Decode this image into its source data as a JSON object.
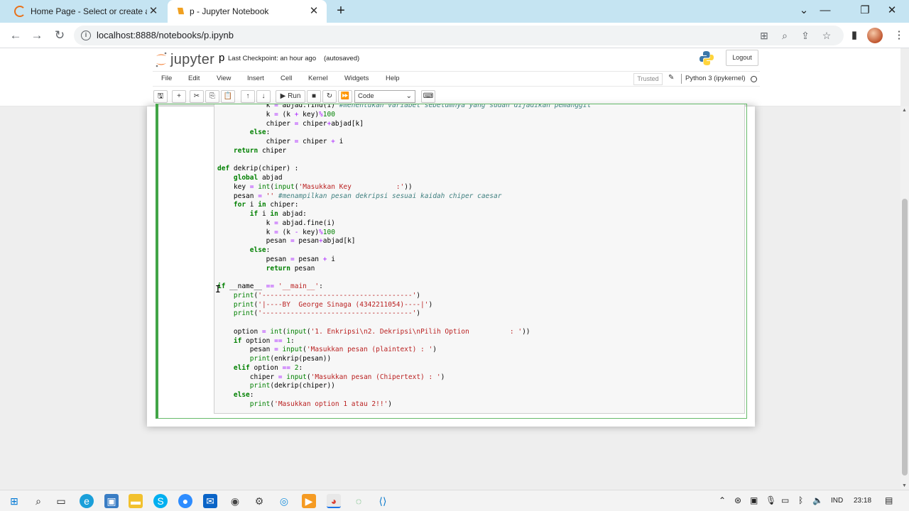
{
  "browser": {
    "tabs": [
      {
        "title": "Home Page - Select or create a n",
        "favicon": "loading-spinner-icon",
        "active": false
      },
      {
        "title": "p - Jupyter Notebook",
        "favicon": "jupyter-icon",
        "active": true
      }
    ],
    "new_tab": "+",
    "url": "localhost:8888/notebooks/p.ipynb",
    "colors": {
      "tab_strip": "#c5e4f2",
      "omnibox": "#f1f3f4"
    }
  },
  "jupyter": {
    "logo_text": "jupyter",
    "notebook_name": "p",
    "checkpoint": "Last Checkpoint: an hour ago",
    "autosave": "(autosaved)",
    "logout": "Logout",
    "menu": [
      "File",
      "Edit",
      "View",
      "Insert",
      "Cell",
      "Kernel",
      "Widgets",
      "Help"
    ],
    "trusted": "Trusted",
    "kernel": "Python 3 (ipykernel)",
    "toolbar": {
      "run": "Run",
      "cell_type": "Code"
    },
    "cell_border_color": "#42a547"
  },
  "code": {
    "lines": [
      "            k = abjad.find(i) #menentukan variabel sebelumnya yang sudah dijadikan pemanggil",
      "            k = (k + key)%100",
      "            chiper = chiper+abjad[k]",
      "        else:",
      "            chiper = chiper + i",
      "    return chiper",
      "",
      "def dekrip(chiper) :",
      "    global abjad",
      "    key = int(input('Masukkan Key           :'))",
      "    pesan = '' #menampilkan pesan dekripsi sesuai kaidah chiper caesar",
      "    for i in chiper:",
      "        if i in abjad:",
      "            k = abjad.fine(i)",
      "            k = (k - key)%100",
      "            pesan = pesan+abjad[k]",
      "        else:",
      "            pesan = pesan + i",
      "            return pesan",
      "",
      "if __name__ == '__main__':",
      "    print('-------------------------------------')",
      "    print('|----BY  George Sinaga (4342211054)----|')",
      "    print('-------------------------------------')",
      "",
      "    option = int(input('1. Enkripsi\\n2. Dekripsi\\nPilih Option          : '))",
      "    if option == 1:",
      "        pesan = input('Masukkan pesan (plaintext) : ')",
      "        print(enkrip(pesan))",
      "    elif option == 2:",
      "        chiper = input('Masukkan pesan (Chipertext) : ')",
      "        print(dekrip(chiper))",
      "    else:",
      "        print('Masukkan option 1 atau 2!!')"
    ]
  },
  "taskbar": {
    "apps": [
      "start-icon",
      "search-icon",
      "task-view-icon",
      "edge-icon",
      "control-panel-icon",
      "file-explorer-icon",
      "skype-icon",
      "zoom-icon",
      "mail-icon",
      "camera-icon",
      "settings-icon",
      "maps-icon",
      "media-player-icon",
      "chrome-icon",
      "app-green-icon",
      "vscode-icon"
    ],
    "language": "IND",
    "time": "23:18"
  }
}
